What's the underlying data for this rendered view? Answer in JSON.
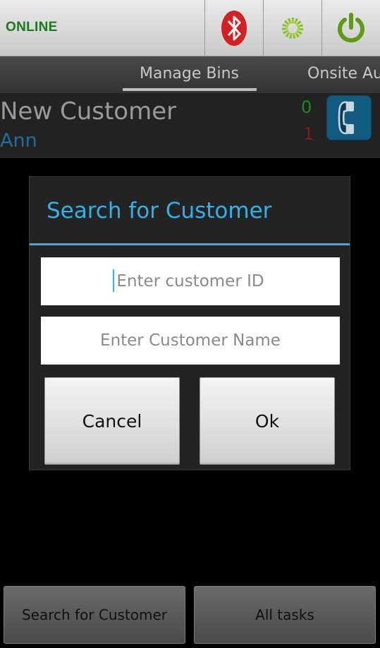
{
  "status": {
    "text": "ONLINE",
    "color": "#1c7a1c"
  },
  "toolbar": {
    "icons": [
      "bluetooth-icon",
      "sync-gear-icon",
      "power-icon"
    ]
  },
  "tabs": [
    {
      "label": "Manage Bins",
      "selected": true
    },
    {
      "label": "Onsite Au",
      "selected": false
    }
  ],
  "customer": {
    "title": "New Customer",
    "name": "Ann",
    "count_green": "0",
    "count_red": "1"
  },
  "dialog": {
    "title": "Search for Customer",
    "id_placeholder": "Enter customer ID",
    "name_placeholder": "Enter Customer Name",
    "cancel_label": "Cancel",
    "ok_label": "Ok",
    "accent": "#33b0e5"
  },
  "bottom": {
    "search_label": "Search for Customer",
    "tasks_label": "All tasks"
  }
}
